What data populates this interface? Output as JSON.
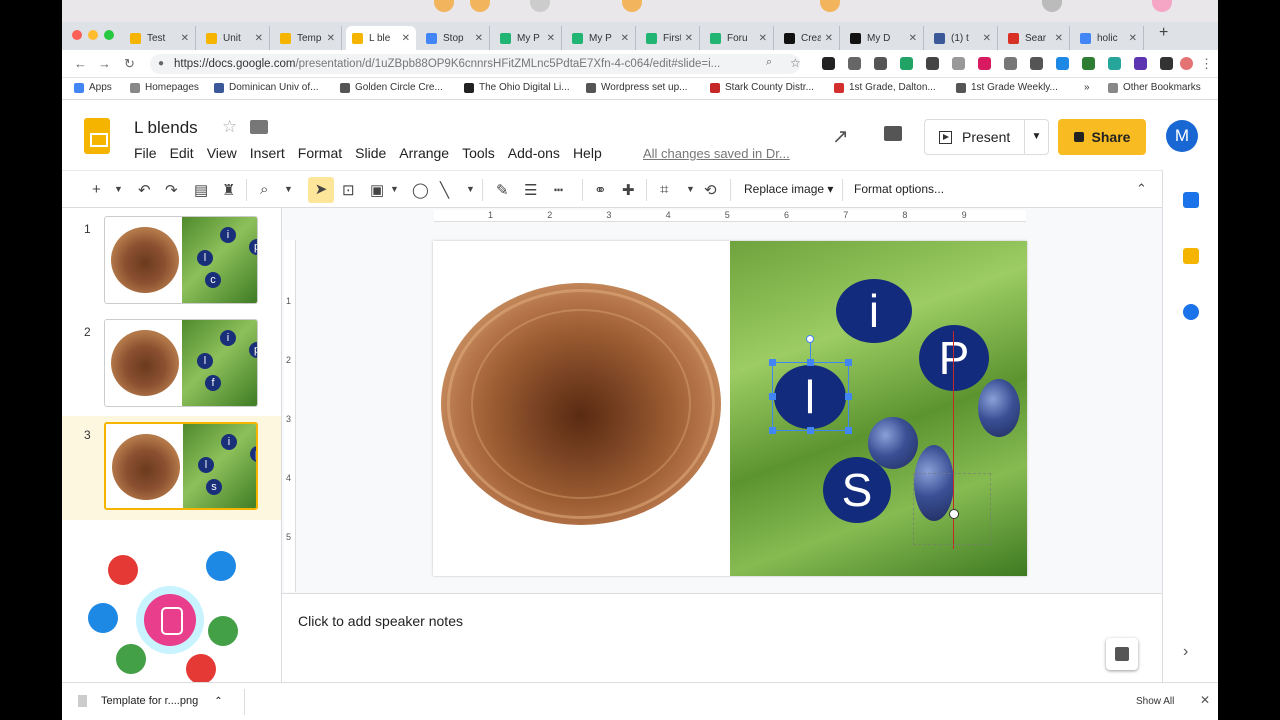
{
  "browser": {
    "tabs": [
      {
        "label": "Test",
        "color": "#f4b400"
      },
      {
        "label": "Unit",
        "color": "#f4b400"
      },
      {
        "label": "Temp",
        "color": "#f4b400"
      },
      {
        "label": "L ble",
        "color": "#f4b400",
        "active": true
      },
      {
        "label": "Stop",
        "color": "#4285f4"
      },
      {
        "label": "My P",
        "color": "#21b573"
      },
      {
        "label": "My P",
        "color": "#21b573"
      },
      {
        "label": "First",
        "color": "#21b573"
      },
      {
        "label": "Foru",
        "color": "#21b573"
      },
      {
        "label": "Crea",
        "color": "#111111"
      },
      {
        "label": "My D",
        "color": "#111111"
      },
      {
        "label": "(1) t",
        "color": "#3b5998"
      },
      {
        "label": "Sear",
        "color": "#d93025"
      },
      {
        "label": "holic",
        "color": "#4285f4"
      }
    ],
    "url_main": "https://docs.google.com",
    "url_rest": "/presentation/d/1uZBpb88OP9K6cnnrsHFitZMLnc5PdtaE7Xfn-4-c064/edit#slide=i...",
    "bookmarks": [
      {
        "label": "Apps",
        "color": "#4285f4"
      },
      {
        "label": "Homepages",
        "color": "#888888"
      },
      {
        "label": "Dominican Univ of...",
        "color": "#3b5998"
      },
      {
        "label": "Golden Circle Cre...",
        "color": "#555555"
      },
      {
        "label": "The Ohio Digital Li...",
        "color": "#222222"
      },
      {
        "label": "Wordpress set up...",
        "color": "#555555"
      },
      {
        "label": "Stark County Distr...",
        "color": "#c62828"
      },
      {
        "label": "1st Grade, Dalton...",
        "color": "#d32f2f"
      },
      {
        "label": "1st Grade Weekly...",
        "color": "#555555"
      },
      {
        "label": "Other Bookmarks",
        "color": "#888888"
      }
    ],
    "bookmarks_more": "»"
  },
  "doc": {
    "title": "L blends",
    "menu": [
      "File",
      "Edit",
      "View",
      "Insert",
      "Format",
      "Slide",
      "Arrange",
      "Tools",
      "Add-ons",
      "Help"
    ],
    "saved_status": "All changes saved in Dr...",
    "present_label": "Present",
    "share_label": "Share",
    "avatar_initial": "M"
  },
  "toolbar": {
    "replace_image": "Replace image ▾",
    "format_options": "Format options..."
  },
  "ruler": {
    "h": [
      "1",
      "2",
      "3",
      "4",
      "5",
      "6",
      "7",
      "8",
      "9"
    ],
    "v": [
      "1",
      "2",
      "3",
      "4",
      "5"
    ]
  },
  "slides": [
    {
      "number": "1",
      "letters": [
        "i",
        "p",
        "l",
        "c"
      ]
    },
    {
      "number": "2",
      "letters": [
        "i",
        "p",
        "l",
        "f"
      ]
    },
    {
      "number": "3",
      "letters": [
        "i",
        "p",
        "l",
        "s"
      ],
      "active": true
    }
  ],
  "canvas": {
    "letters": {
      "i": "i",
      "p": "P",
      "l": "l",
      "s": "S"
    }
  },
  "notes": {
    "placeholder": "Click to add speaker notes"
  },
  "download": {
    "file": "Template for r....png",
    "show_all": "Show All"
  }
}
